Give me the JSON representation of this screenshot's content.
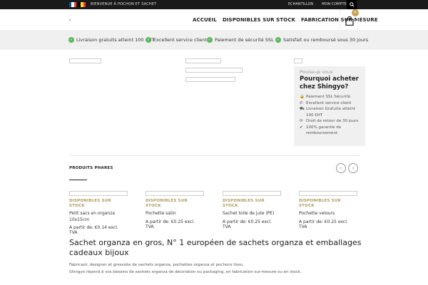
{
  "topbar": {
    "welcome": "BIENVENUE À POCHON ET SACHET",
    "links": [
      "ECHANTILLON",
      "MON COMPTE"
    ],
    "flags": [
      "flag-france",
      "flag-belgium"
    ]
  },
  "header": {
    "nav": [
      "ACCUEIL",
      "DISPONIBLES SUR STOCK",
      "FABRICATION SUR MESURE"
    ],
    "cart_count": "0"
  },
  "benefits": [
    "Livraison gratuits atteint 100 €HT",
    "Excellent service client",
    "Paiement de sécurité SSL",
    "Satisfait ou remboursé sous 30 jours"
  ],
  "why": {
    "pre": "Pouise-je vous",
    "title": "Pourquoi acheter chez Shingyo?",
    "items": [
      {
        "icon": "lock-icon",
        "glyph": "🔒",
        "text": "Paiement SSL Sécurité"
      },
      {
        "icon": "phone-icon",
        "glyph": "✆",
        "text": "Excellent service client"
      },
      {
        "icon": "truck-icon",
        "glyph": "⛟",
        "text": "Livraison Gratuite atteint 100 €HT"
      },
      {
        "icon": "refresh-icon",
        "glyph": "⟳",
        "text": "Droit de retour de 30 jours"
      },
      {
        "icon": "check-circle-icon",
        "glyph": "✔",
        "text": "100% garantie de remboursement"
      }
    ]
  },
  "products_section": {
    "title": "PRODUITS PHARES",
    "prev": "‹",
    "next": "›",
    "items": [
      {
        "category": "DISPONIBLES SUR STOCK",
        "name": "Petit sacs en organza 10x15cm",
        "price": "A partir de: €0.14 excl. TVA"
      },
      {
        "category": "DISPONIBLES SUR STOCK",
        "name": "Pochette satin",
        "price": "A partir de: €0.25 excl. TVA"
      },
      {
        "category": "DISPONIBLES SUR STOCK",
        "name": "Sachet toile de jute (PE)",
        "price": "A partir de: €0.25 excl. TVA"
      },
      {
        "category": "DISPONIBLES SUR STOCK",
        "name": "Pochette velours",
        "price": "A partir de: €0.25 excl. TVA"
      }
    ]
  },
  "intro": {
    "headline": "Sachet organza en gros, N° 1 européen de sachets organza et emballages cadeaux bijoux",
    "line1": "Fabricant, designer et grossiste de sachets organza, pochettes organza et pochons tissu.",
    "line2": "Shingyo répond à vos besoins de sachets organza de décoration ou packaging, en fabrication sur-mesure ou en stock."
  },
  "colors": {
    "accent_gold": "#b09a5e",
    "check_green": "#5cb85c",
    "topbar": "#1a1a1a"
  }
}
